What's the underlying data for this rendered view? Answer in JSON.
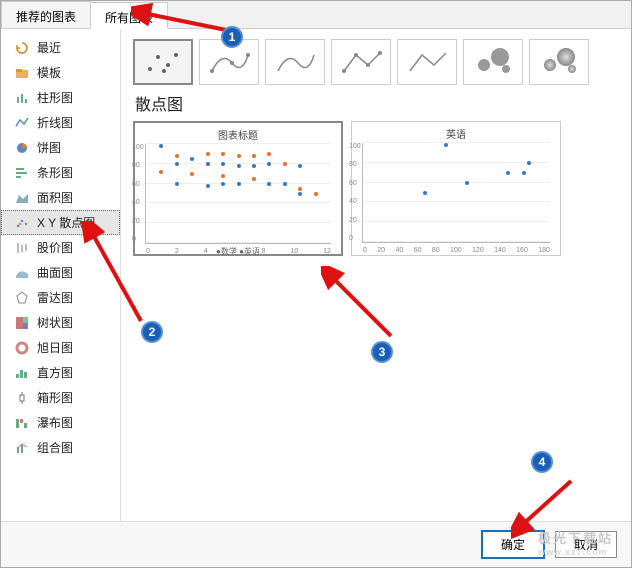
{
  "tabs": {
    "recommended": "推荐的图表",
    "all": "所有图表"
  },
  "sidebar": {
    "items": [
      {
        "label": "最近"
      },
      {
        "label": "模板"
      },
      {
        "label": "柱形图"
      },
      {
        "label": "折线图"
      },
      {
        "label": "饼图"
      },
      {
        "label": "条形图"
      },
      {
        "label": "面积图"
      },
      {
        "label": "X Y 散点图"
      },
      {
        "label": "股价图"
      },
      {
        "label": "曲面图"
      },
      {
        "label": "雷达图"
      },
      {
        "label": "树状图"
      },
      {
        "label": "旭日图"
      },
      {
        "label": "直方图"
      },
      {
        "label": "箱形图"
      },
      {
        "label": "瀑布图"
      },
      {
        "label": "组合图"
      }
    ]
  },
  "section_title": "散点图",
  "previews": {
    "a": {
      "title": "图表标题",
      "legend": "●数学  ●英语"
    },
    "b": {
      "title": "英语"
    }
  },
  "buttons": {
    "ok": "确定",
    "cancel": "取消"
  },
  "badges": {
    "b1": "1",
    "b2": "2",
    "b3": "3",
    "b4": "4"
  },
  "watermark": {
    "line1": "极光下载站",
    "line2": "www.xz7.com"
  },
  "colors": {
    "accent": "#1a5fb4",
    "series1": "#3b78c4",
    "series2": "#e8722a"
  },
  "chart_data": [
    {
      "type": "scatter",
      "title": "图表标题",
      "xlabel": "",
      "ylabel": "",
      "xlim": [
        0,
        12
      ],
      "ylim": [
        0,
        100
      ],
      "xticks": [
        0,
        2,
        4,
        6,
        8,
        10,
        12
      ],
      "yticks": [
        0,
        20,
        40,
        60,
        80,
        100
      ],
      "series": [
        {
          "name": "数学",
          "color": "#3b78c4",
          "points": [
            [
              1,
              98
            ],
            [
              2,
              80
            ],
            [
              2,
              60
            ],
            [
              3,
              85
            ],
            [
              4,
              58
            ],
            [
              4,
              80
            ],
            [
              5,
              80
            ],
            [
              5,
              60
            ],
            [
              6,
              78
            ],
            [
              6,
              60
            ],
            [
              7,
              78
            ],
            [
              8,
              60
            ],
            [
              8,
              80
            ],
            [
              9,
              60
            ],
            [
              10,
              50
            ],
            [
              10,
              78
            ]
          ]
        },
        {
          "name": "英语",
          "color": "#e8722a",
          "points": [
            [
              1,
              72
            ],
            [
              2,
              88
            ],
            [
              3,
              70
            ],
            [
              4,
              90
            ],
            [
              5,
              68
            ],
            [
              5,
              90
            ],
            [
              6,
              88
            ],
            [
              7,
              88
            ],
            [
              7,
              65
            ],
            [
              8,
              90
            ],
            [
              9,
              80
            ],
            [
              10,
              55
            ],
            [
              11,
              50
            ]
          ]
        }
      ]
    },
    {
      "type": "scatter",
      "title": "英语",
      "xlabel": "",
      "ylabel": "",
      "xlim": [
        0,
        180
      ],
      "ylim": [
        0,
        100
      ],
      "xticks": [
        0,
        20,
        40,
        60,
        80,
        100,
        120,
        140,
        160,
        180
      ],
      "yticks": [
        0,
        20,
        40,
        60,
        80,
        100
      ],
      "series": [
        {
          "name": "英语",
          "color": "#3b78c4",
          "points": [
            [
              60,
              50
            ],
            [
              80,
              98
            ],
            [
              100,
              60
            ],
            [
              140,
              70
            ],
            [
              155,
              70
            ],
            [
              160,
              80
            ]
          ]
        }
      ]
    }
  ]
}
